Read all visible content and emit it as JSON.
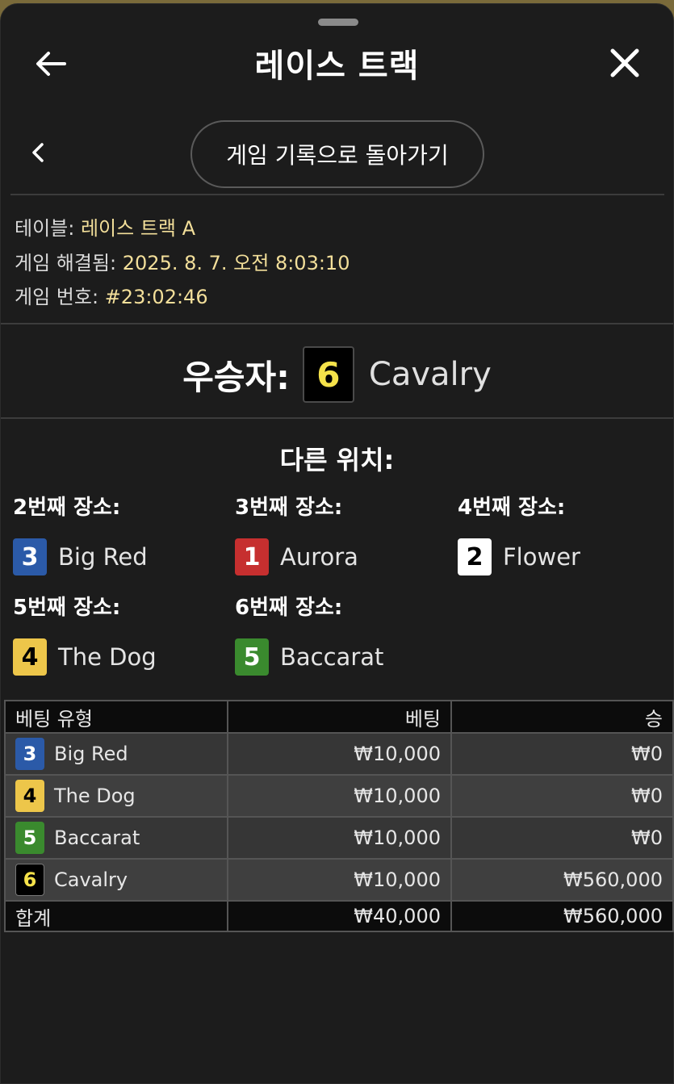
{
  "header": {
    "title": "레이스 트랙",
    "back_link_label": "게임 기록으로 돌아가기"
  },
  "info": {
    "table_label": "테이블:",
    "table_value": "레이스 트랙 A",
    "resolved_label": "게임 해결됨:",
    "resolved_value": "2025. 8. 7. 오전 8:03:10",
    "game_no_label": "게임 번호:",
    "game_no_value": "#23:02:46"
  },
  "winner": {
    "label": "우승자:",
    "number": "6",
    "name": "Cavalry",
    "color": "black"
  },
  "other_positions": {
    "heading": "다른 위치:",
    "places": [
      {
        "label": "2번째 장소:",
        "number": "3",
        "name": "Big Red",
        "color": "blue"
      },
      {
        "label": "3번째 장소:",
        "number": "1",
        "name": "Aurora",
        "color": "red"
      },
      {
        "label": "4번째 장소:",
        "number": "2",
        "name": "Flower",
        "color": "white"
      },
      {
        "label": "5번째 장소:",
        "number": "4",
        "name": "The Dog",
        "color": "yellow"
      },
      {
        "label": "6번째 장소:",
        "number": "5",
        "name": "Baccarat",
        "color": "green"
      }
    ]
  },
  "bets_table": {
    "headers": {
      "type": "베팅 유형",
      "bet": "베팅",
      "win": "승"
    },
    "rows": [
      {
        "number": "3",
        "name": "Big Red",
        "color": "blue",
        "bet": "₩10,000",
        "win": "₩0"
      },
      {
        "number": "4",
        "name": "The Dog",
        "color": "yellow",
        "bet": "₩10,000",
        "win": "₩0"
      },
      {
        "number": "5",
        "name": "Baccarat",
        "color": "green",
        "bet": "₩10,000",
        "win": "₩0"
      },
      {
        "number": "6",
        "name": "Cavalry",
        "color": "black",
        "bet": "₩10,000",
        "win": "₩560,000"
      }
    ],
    "total": {
      "label": "합계",
      "bet": "₩40,000",
      "win": "₩560,000"
    }
  },
  "colors": {
    "blue": "#2b5aa8",
    "red": "#c62f2f",
    "white": "#ffffff",
    "yellow": "#edc64a",
    "green": "#3a8a2e",
    "black": "#000000",
    "accent_value": "#f3df9a"
  },
  "icons": {
    "back": "arrow-left-icon",
    "close": "close-x-icon",
    "chevron": "chevron-left-icon"
  }
}
